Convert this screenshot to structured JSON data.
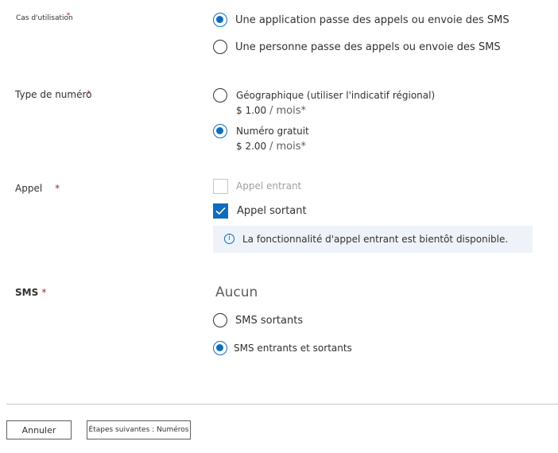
{
  "usage": {
    "label": "Cas d'utilisation",
    "required_mark": "*",
    "options": [
      {
        "label": "Une application passe des appels ou envoie des SMS",
        "selected": true
      },
      {
        "label": "Une personne passe des appels ou envoie des SMS",
        "selected": false
      }
    ]
  },
  "number_type": {
    "label": "Type de numéro",
    "required_mark": "*",
    "options": [
      {
        "label": "Géographique (utiliser l'indicatif régional)",
        "price": "$ 1.00",
        "unit": "/ mois*",
        "selected": false
      },
      {
        "label": "Numéro gratuit",
        "price": "$ 2.00",
        "unit": "/ mois*",
        "selected": true
      }
    ]
  },
  "calling": {
    "label": "Appel",
    "required_mark": "*",
    "options": [
      {
        "label": "Appel entrant",
        "checked": false,
        "disabled": true
      },
      {
        "label": "Appel sortant",
        "checked": true,
        "disabled": false
      }
    ],
    "info": "La fonctionnalité d'appel entrant est bientôt disponible."
  },
  "sms": {
    "label": "SMS",
    "required_mark": "*",
    "heading": "Aucun",
    "options": [
      {
        "label": "SMS sortants",
        "selected": false
      },
      {
        "label": "SMS entrants et sortants",
        "selected": true
      }
    ]
  },
  "footer": {
    "cancel_label": "Annuler",
    "next_label": "Étapes suivantes : Numéros"
  },
  "colors": {
    "accent": "#0f6cbd",
    "required": "#a4262c"
  }
}
